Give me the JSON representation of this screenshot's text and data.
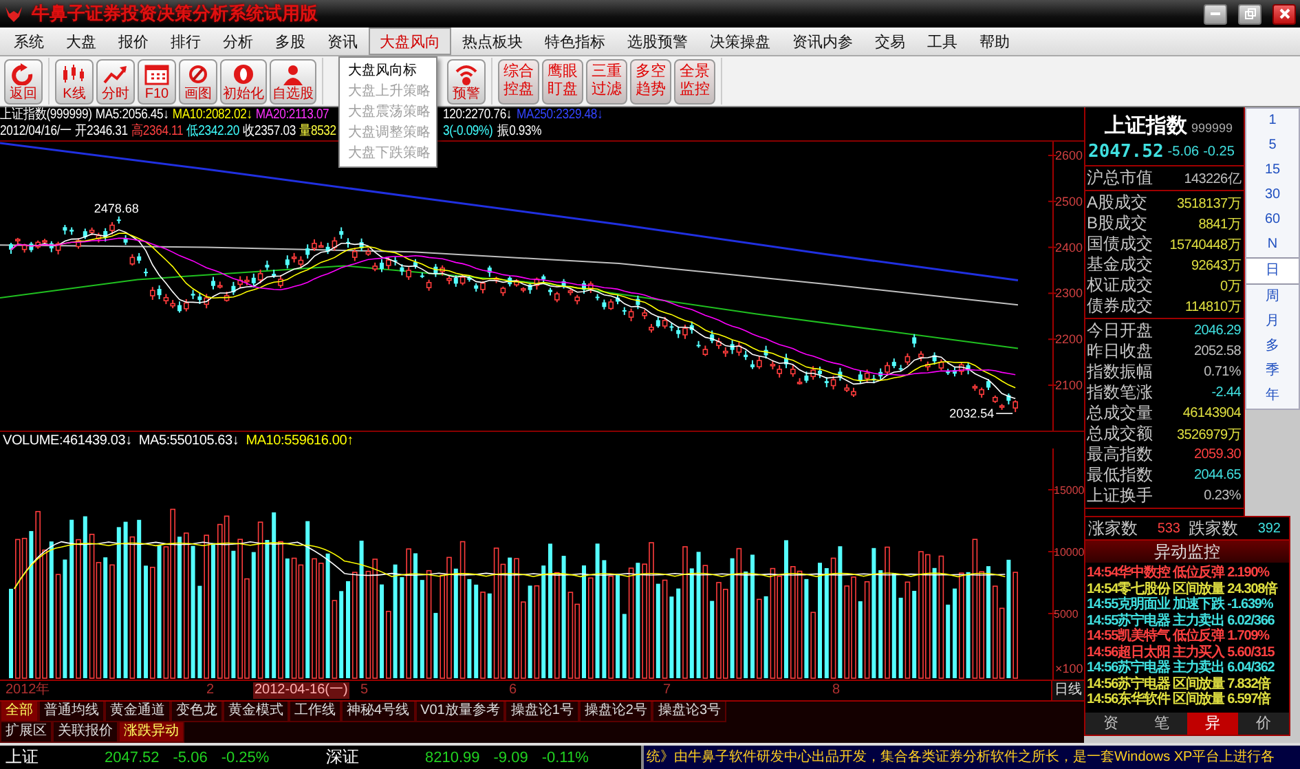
{
  "window": {
    "title": "牛鼻子证券投资决策分析系统试用版"
  },
  "menu": [
    {
      "label": "系统",
      "selected": false
    },
    {
      "label": "大盘",
      "selected": false
    },
    {
      "label": "报价",
      "selected": false
    },
    {
      "label": "排行",
      "selected": false
    },
    {
      "label": "分析",
      "selected": false
    },
    {
      "label": "多股",
      "selected": false
    },
    {
      "label": "资讯",
      "selected": false
    },
    {
      "label": "大盘风向",
      "selected": true
    },
    {
      "label": "热点板块",
      "selected": false
    },
    {
      "label": "特色指标",
      "selected": false
    },
    {
      "label": "选股预警",
      "selected": false
    },
    {
      "label": "决策操盘",
      "selected": false
    },
    {
      "label": "资讯内参",
      "selected": false
    },
    {
      "label": "交易",
      "selected": false
    },
    {
      "label": "工具",
      "selected": false
    },
    {
      "label": "帮助",
      "selected": false
    }
  ],
  "toolbar": [
    [
      {
        "kind": "icon",
        "label": "返回"
      }
    ],
    [
      {
        "kind": "icon",
        "label": "K线"
      },
      {
        "kind": "icon",
        "label": "分时"
      },
      {
        "kind": "icon",
        "label": "F10"
      },
      {
        "kind": "icon",
        "label": "画图"
      },
      {
        "kind": "icon",
        "label": "初始化"
      },
      {
        "kind": "icon",
        "label": "自选股"
      }
    ],
    [
      {
        "kind": "icon",
        "label": "预警"
      }
    ],
    [
      {
        "kind": "text",
        "label": "综合控盘"
      },
      {
        "kind": "text",
        "label": "鹰眼盯盘"
      },
      {
        "kind": "text",
        "label": "三重过滤"
      },
      {
        "kind": "text",
        "label": "多空趋势"
      },
      {
        "kind": "text",
        "label": "全景监控"
      }
    ]
  ],
  "dropdown": [
    {
      "label": "大盘风向标",
      "disabled": false
    },
    {
      "label": "大盘上升策略",
      "disabled": true
    },
    {
      "label": "大盘震荡策略",
      "disabled": true
    },
    {
      "label": "大盘调整策略",
      "disabled": true
    },
    {
      "label": "大盘下跌策略",
      "disabled": true
    }
  ],
  "chart": {
    "header_lines": [
      {
        "left": [
          {
            "text": "上证指数(999999)",
            "color": "#ffffff"
          },
          {
            "text": "MA5:2056.45↓",
            "color": "#ffffff"
          },
          {
            "text": "MA10:2082.02↓",
            "color": "#ffff00"
          },
          {
            "text": "MA20:2113.07",
            "color": "#ff33ff"
          }
        ],
        "right": [
          {
            "text": "120:2270.76↓",
            "color": "#ffffff"
          },
          {
            "text": "MA250:2329.48↓",
            "color": "#3344ff"
          }
        ]
      },
      {
        "left": [
          {
            "text": "2012/04/16/一",
            "color": "#ffffff"
          },
          {
            "text": "开2346.31",
            "color": "#ffffff"
          },
          {
            "text": "高2364.11",
            "color": "#ff4040"
          },
          {
            "text": "低2342.20",
            "color": "#40ffff"
          },
          {
            "text": "收2357.03",
            "color": "#ffffff"
          },
          {
            "text": "量8532",
            "color": "#ffff40"
          }
        ],
        "right": [
          {
            "text": "3(-0.09%)",
            "color": "#40ffff"
          },
          {
            "text": "振0.93%",
            "color": "#ffffff"
          }
        ]
      }
    ],
    "price_axis": [
      "2600",
      "2500",
      "2400",
      "2300",
      "2200",
      "2100"
    ],
    "high_label": "2478.68",
    "low_label": "2032.54",
    "volume_header": [
      {
        "text": "VOLUME:461439.03↓",
        "color": "#ffffff"
      },
      {
        "text": "MA5:550105.63↓",
        "color": "#ffffff"
      },
      {
        "text": "MA10:559616.00↑",
        "color": "#ffff00"
      }
    ],
    "volume_axis": [
      "15000",
      "10000",
      "5000"
    ],
    "volume_unit": "×100",
    "x_axis": [
      {
        "label": "2012年",
        "selected": false
      },
      {
        "label": "2",
        "selected": false
      },
      {
        "label": "2012-04-16(一)",
        "selected": true
      },
      {
        "label": "5",
        "selected": false
      },
      {
        "label": "6",
        "selected": false
      },
      {
        "label": "7",
        "selected": false
      },
      {
        "label": "8",
        "selected": false
      }
    ],
    "period_label": "日线"
  },
  "indicator_tabs": [
    [
      {
        "label": "全部",
        "selected": true
      },
      {
        "label": "普通均线",
        "selected": false
      },
      {
        "label": "黄金通道",
        "selected": false
      },
      {
        "label": "变色龙",
        "selected": false
      },
      {
        "label": "黄金模式",
        "selected": false
      },
      {
        "label": "工作线",
        "selected": false
      },
      {
        "label": "神秘4号线",
        "selected": false
      },
      {
        "label": "V01放量参考",
        "selected": false
      },
      {
        "label": "操盘论1号",
        "selected": false
      },
      {
        "label": "操盘论2号",
        "selected": false
      },
      {
        "label": "操盘论3号",
        "selected": false
      }
    ],
    [
      {
        "label": "扩展区",
        "selected": false
      },
      {
        "label": "关联报价",
        "selected": false
      },
      {
        "label": "涨跌异动",
        "selected": true
      }
    ]
  ],
  "quote": {
    "name": "上证指数",
    "code": "999999",
    "price": "2047.52",
    "change": "-5.06",
    "percent": "-0.25",
    "groups": [
      [
        {
          "label": "沪总市值",
          "value": "143226亿",
          "color": "#c0c0c0"
        }
      ],
      [
        {
          "label": "A股成交",
          "value": "3518137万",
          "color": "#e0e040"
        },
        {
          "label": "B股成交",
          "value": "8841万",
          "color": "#e0e040"
        },
        {
          "label": "国债成交",
          "value": "15740448万",
          "color": "#e0e040"
        },
        {
          "label": "基金成交",
          "value": "92643万",
          "color": "#e0e040"
        },
        {
          "label": "权证成交",
          "value": "0万",
          "color": "#e0e040"
        },
        {
          "label": "债券成交",
          "value": "114810万",
          "color": "#e0e040"
        }
      ],
      [
        {
          "label": "今日开盘",
          "value": "2046.29",
          "color": "#40e0e0"
        },
        {
          "label": "昨日收盘",
          "value": "2052.58",
          "color": "#c0c0c0"
        },
        {
          "label": "指数振幅",
          "value": "0.71%",
          "color": "#c0c0c0"
        },
        {
          "label": "指数笔涨",
          "value": "-2.44",
          "color": "#40e0e0"
        },
        {
          "label": "总成交量",
          "value": "46143904",
          "color": "#e0e040"
        },
        {
          "label": "总成交额",
          "value": "3526979万",
          "color": "#e0e040"
        },
        {
          "label": "最高指数",
          "value": "2059.30",
          "color": "#ff4040"
        },
        {
          "label": "最低指数",
          "value": "2044.65",
          "color": "#40e0e0"
        },
        {
          "label": "上证换手",
          "value": "0.23%",
          "color": "#c0c0c0"
        }
      ]
    ],
    "breadth": [
      {
        "label": "涨家数",
        "value": "533",
        "color": "#ff4040"
      },
      {
        "label": "跌家数",
        "value": "392",
        "color": "#40e0e0"
      }
    ]
  },
  "periods": [
    {
      "label": "1",
      "selected": false
    },
    {
      "label": "5",
      "selected": false
    },
    {
      "label": "15",
      "selected": false
    },
    {
      "label": "30",
      "selected": false
    },
    {
      "label": "60",
      "selected": false
    },
    {
      "label": "N",
      "selected": false
    },
    {
      "label": "日",
      "selected": true
    },
    {
      "label": "周",
      "selected": false
    },
    {
      "label": "月",
      "selected": false
    },
    {
      "label": "多",
      "selected": false
    },
    {
      "label": "季",
      "selected": false
    },
    {
      "label": "年",
      "selected": false
    }
  ],
  "alerts": {
    "title": "异动监控",
    "items": [
      {
        "text": "14:54华中数控 低位反弹 2.190%",
        "color": "#ff4040"
      },
      {
        "text": "14:54零七股份 区间放量 24.308倍",
        "color": "#e0e040"
      },
      {
        "text": "14:55克明面业 加速下跌 -1.639%",
        "color": "#40e0e0"
      },
      {
        "text": "14:55苏宁电器 主力卖出 6.02/366",
        "color": "#40e0e0"
      },
      {
        "text": "14:55凯美特气 低位反弹 1.709%",
        "color": "#ff4040"
      },
      {
        "text": "14:56超日太阳 主力买入 5.60/315",
        "color": "#ff4040"
      },
      {
        "text": "14:56苏宁电器 主力卖出 6.04/362",
        "color": "#40e0e0"
      },
      {
        "text": "14:56苏宁电器 区间放量 7.832倍",
        "color": "#e0e040"
      },
      {
        "text": "14:56东华软件 区间放量 6.597倍",
        "color": "#e0e040"
      }
    ],
    "tabs": [
      {
        "label": "资",
        "selected": false
      },
      {
        "label": "笔",
        "selected": false
      },
      {
        "label": "异",
        "selected": true
      },
      {
        "label": "价",
        "selected": false
      }
    ]
  },
  "status_bar": {
    "indices": [
      {
        "name": "上证",
        "value": "2047.52",
        "change": "-5.06",
        "percent": "-0.25%"
      },
      {
        "name": "深证",
        "value": "8210.99",
        "change": "-9.09",
        "percent": "-0.11%"
      }
    ],
    "marquee": "统》由牛鼻子软件研发中心出品开发，集合各类证券分析软件之所长，是一套Windows XP平台上进行各"
  }
}
